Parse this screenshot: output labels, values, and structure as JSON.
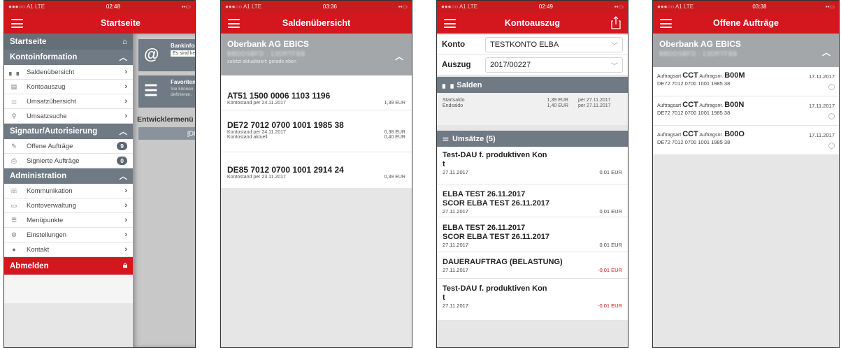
{
  "status": {
    "carrier": "●●●○○ A1  LTE",
    "battery": "▪▪▭"
  },
  "phone1": {
    "time": "02:48",
    "nav_title": "Startseite",
    "menu": {
      "startseite": "Startseite",
      "kontoinfo": "Kontoinformation",
      "kontoinfo_items": [
        "Saldenübersicht",
        "Kontoauszug",
        "Umsatzübersicht",
        "Umsatzsuche"
      ],
      "signatur": "Signatur/Autorisierung",
      "offene": "Offene Aufträge",
      "offene_count": "9",
      "signierte": "Signierte Aufträge",
      "signierte_count": "0",
      "admin": "Administration",
      "admin_items": [
        "Kommunikation",
        "Kontoverwaltung",
        "Menüpunkte",
        "Einstellungen",
        "Kontakt"
      ],
      "logout": "Abmelden"
    },
    "behind": {
      "card1_title": "Bankinfor",
      "card1_sub": "Es sind kein",
      "card2_title": "Favoriten",
      "card2_sub1": "Sie können",
      "card2_sub2": "definieren.",
      "dev_title": "Entwicklermenü",
      "dev_bar": "[DE"
    }
  },
  "phone2": {
    "time": "03:36",
    "nav_title": "Saldenübersicht",
    "bank_name": "Oberbank AG EBICS",
    "bank_id": "BBDDSBFD : 13DRTFBB",
    "updated": "zuletzt aktualisiert: gerade eben",
    "accounts": [
      {
        "iban": "AT51 1500 0006 1103 1196",
        "lines": [
          {
            "label": "Kontostand per 24.11.2017",
            "value": "1,39 EUR"
          }
        ]
      },
      {
        "iban": "DE72 7012 0700 1001 1985 38",
        "lines": [
          {
            "label": "Kontostand per 24.11.2017",
            "value": "0,38 EUR"
          },
          {
            "label": "Kontostand aktuell",
            "value": "0,40 EUR"
          }
        ]
      },
      {
        "iban": "DE85 7012 0700 1001 2914 24",
        "lines": [
          {
            "label": "Kontostand per 23.11.2017",
            "value": "0,39 EUR"
          }
        ]
      }
    ]
  },
  "phone3": {
    "time": "02:49",
    "nav_title": "Kontoauszug",
    "konto_label": "Konto",
    "konto_value": "TESTKONTO ELBA",
    "auszug_label": "Auszug",
    "auszug_value": "2017/00227",
    "salden_title": "Salden",
    "salden": [
      {
        "label": "Startsaldo",
        "value": "1,39 EUR",
        "date": "per 27.11.2017"
      },
      {
        "label": "Endsaldo",
        "value": "1,40 EUR",
        "date": "per 27.11.2017"
      }
    ],
    "umsaetze_title": "Umsätze (5)",
    "transactions": [
      {
        "title": "Test-DAU f. produktiven Kon\nt",
        "date": "27.11.2017",
        "amount": "0,01 EUR"
      },
      {
        "title": "ELBA TEST 26.11.2017\nSCOR ELBA TEST 26.11.2017",
        "date": "27.11.2017",
        "amount": "0,01 EUR"
      },
      {
        "title": "ELBA TEST 26.11.2017\nSCOR ELBA TEST 26.11.2017",
        "date": "27.11.2017",
        "amount": "0,01 EUR"
      },
      {
        "title": "DAUERAUFTRAG (BELASTUNG)",
        "date": "27.11.2017",
        "amount": "-0,01 EUR"
      },
      {
        "title": "Test-DAU f. produktiven Kon\nt",
        "date": "27.11.2017",
        "amount": "-0,01 EUR"
      }
    ]
  },
  "phone4": {
    "time": "03:38",
    "nav_title": "Offene Aufträge",
    "bank_name": "Oberbank AG EBICS",
    "bank_id": "BBDDSBFD : 13DRTFBB",
    "orders": [
      {
        "art_label": "Auftragsart",
        "art": "CCT",
        "nr_label": "Auftragsnr.",
        "nr": "B00M",
        "date": "17.11.2017",
        "iban": "DE72 7012 0700 1001 1985 38"
      },
      {
        "art_label": "Auftragsart",
        "art": "CCT",
        "nr_label": "Auftragsnr.",
        "nr": "B00N",
        "date": "17.11.2017",
        "iban": "DE72 7012 0700 1001 1985 38"
      },
      {
        "art_label": "Auftragsart",
        "art": "CCT",
        "nr_label": "Auftragsnr.",
        "nr": "B00O",
        "date": "17.11.2017",
        "iban": "DE72 7012 0700 1001 1985 38"
      }
    ]
  },
  "colors": {
    "brand_red": "#d4171e",
    "section_gray": "#6f7a84",
    "header_gray": "#a4a7aa",
    "negative": "#d4171e"
  },
  "icons": [
    "hamburger-icon",
    "home-icon",
    "chevron-right-icon",
    "chevron-up-icon",
    "lock-icon",
    "share-icon",
    "at-icon",
    "list-icon"
  ]
}
